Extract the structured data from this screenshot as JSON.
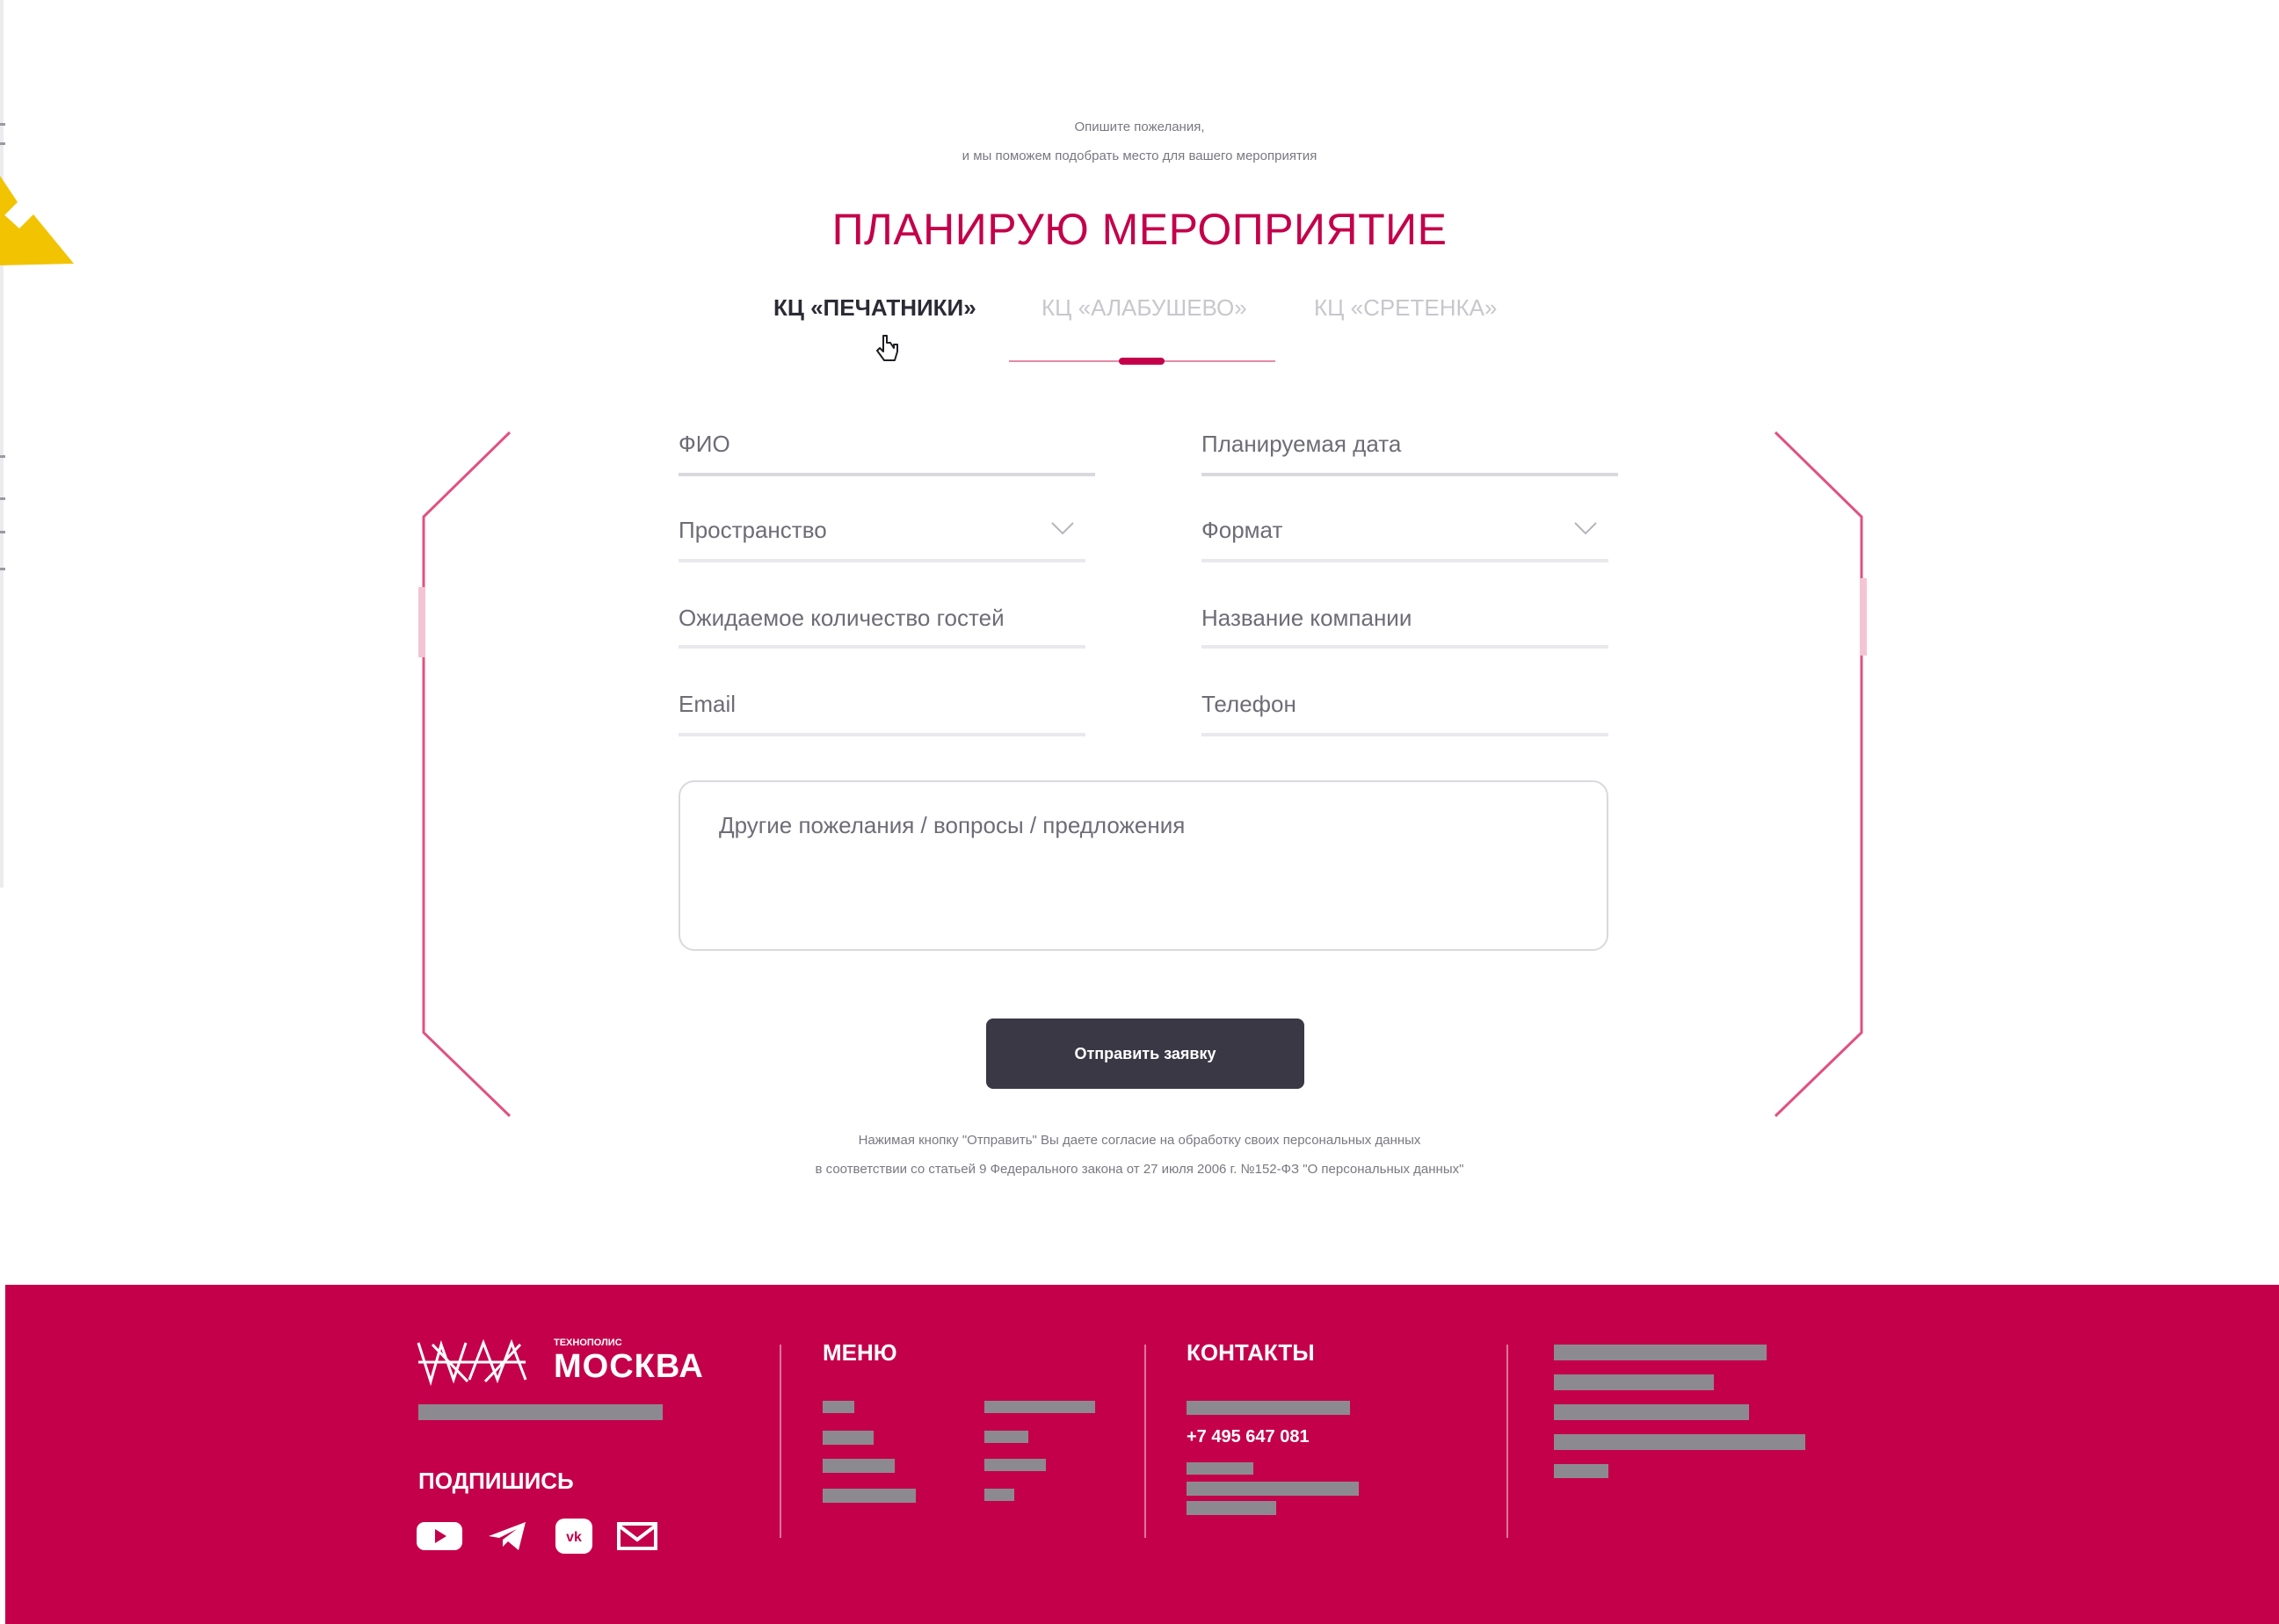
{
  "intro": {
    "line1": "Опишите пожелания,",
    "line2": "и мы поможем подобрать место для вашего мероприятия"
  },
  "title": "ПЛАНИРУЮ МЕРОПРИЯТИЕ",
  "tabs": [
    {
      "label": "КЦ «ПЕЧАТНИКИ»",
      "active": true
    },
    {
      "label": "КЦ «АЛАБУШЕВО»",
      "active": false
    },
    {
      "label": "КЦ «СРЕТЕНКА»",
      "active": false
    }
  ],
  "form": {
    "fio": "ФИО",
    "date": "Планируемая дата",
    "space": "Пространство",
    "format": "Формат",
    "guests": "Ожидаемое количество гостей",
    "company": "Название компании",
    "email": "Email",
    "phone": "Телефон",
    "comments": "Другие пожелания / вопросы / предложения",
    "submit": "Отправить заявку"
  },
  "consent": {
    "line1": "Нажимая кнопку \"Отправить\" Вы даете согласие на обработку своих персональных данных",
    "line2": "в соответствии со статьей 9 Федерального закона от 27 июля 2006 г. №152-ФЗ \"О персональных данных\""
  },
  "footer": {
    "logo_small": "ТЕХНОПОЛИС",
    "logo_main": "МОСКВА",
    "subscribe": "ПОДПИШИСЬ",
    "menu_title": "МЕНЮ",
    "contacts_title": "КОНТАКТЫ",
    "phone": "+7 495 647 081",
    "social_icons": [
      "youtube-icon",
      "telegram-icon",
      "vk-icon",
      "mail-icon"
    ]
  },
  "colors": {
    "accent": "#c4004a",
    "button": "#3a3844",
    "footer": "#c4004a",
    "arrow": "#f2c300"
  }
}
